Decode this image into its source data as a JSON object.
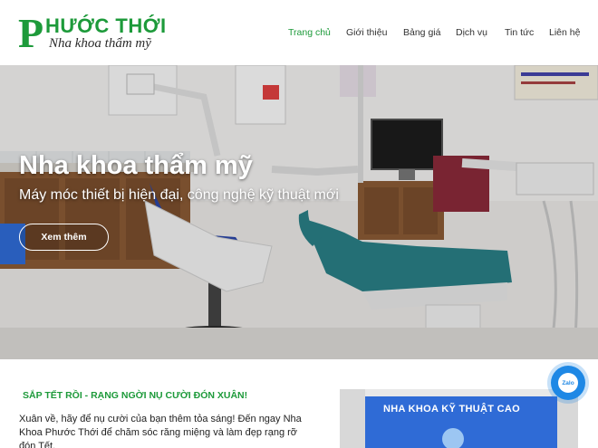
{
  "logo": {
    "letter": "P",
    "brand": "HƯỚC THỚI",
    "tagline": "Nha khoa thẩm mỹ"
  },
  "nav": {
    "items": [
      {
        "label": "Trang chủ",
        "active": true
      },
      {
        "label": "Giới thiệu",
        "active": false
      },
      {
        "label": "Bảng giá",
        "active": false
      },
      {
        "label": "Dịch vụ",
        "active": false
      },
      {
        "label": "Tin tức",
        "active": false
      },
      {
        "label": "Liên hệ",
        "active": false
      }
    ]
  },
  "hero": {
    "title": "Nha khoa thẩm mỹ",
    "subtitle": "Máy móc thiết bị hiện đại, công nghệ kỹ thuật mới",
    "button_label": "Xem thêm"
  },
  "promo": {
    "title": "SẮP TẾT RỒI - RẠNG NGỜI NỤ CƯỜI ĐÓN XUÂN!",
    "text": "Xuân về, hãy để nụ cười của bạn thêm tỏa sáng! Đến ngay Nha Khoa Phước Thới để chăm sóc răng miệng và làm đẹp rạng rỡ đón Tết.",
    "image_sign": "NHA KHOA KỸ THUẬT CAO"
  },
  "zalo": {
    "label": "Zalo"
  },
  "colors": {
    "brand_green": "#1d9a3a",
    "chair_teal": "#2a7f86",
    "chair_blue": "#2b46a8",
    "zalo_blue": "#1e88e5"
  }
}
